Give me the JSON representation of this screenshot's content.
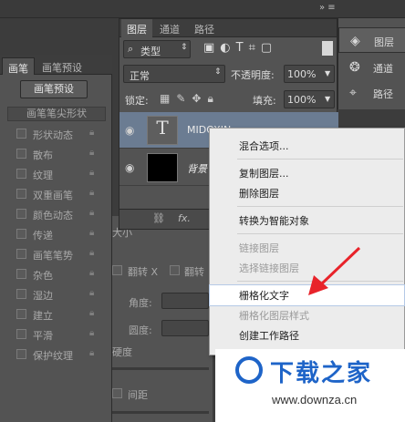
{
  "brush_panel": {
    "tabs": [
      "画笔",
      "画笔预设"
    ],
    "preset_button": "画笔预设",
    "section_title": "画笔笔尖形状",
    "options": [
      {
        "label": "形状动态",
        "locked": true
      },
      {
        "label": "散布",
        "locked": true
      },
      {
        "label": "纹理",
        "locked": true
      },
      {
        "label": "双重画笔",
        "locked": true
      },
      {
        "label": "颜色动态",
        "locked": true
      },
      {
        "label": "传递",
        "locked": true
      },
      {
        "label": "画笔笔势",
        "locked": true
      },
      {
        "label": "杂色",
        "locked": true
      },
      {
        "label": "湿边",
        "locked": true
      },
      {
        "label": "建立",
        "locked": true
      },
      {
        "label": "平滑",
        "locked": true
      },
      {
        "label": "保护纹理",
        "locked": true
      }
    ],
    "flip_x": "翻转 X",
    "flip_y": "翻转",
    "angle_label": "角度:",
    "roundness_label": "圆度:",
    "hardness_label": "硬度",
    "spacing_label": "间距",
    "size_label": "大小"
  },
  "layers_panel": {
    "tabs": [
      "图层",
      "通道",
      "路径"
    ],
    "filter_label": "类型",
    "blend_mode": "正常",
    "opacity_label": "不透明度:",
    "opacity_value": "100%",
    "lock_label": "锁定:",
    "fill_label": "填充:",
    "fill_value": "100%",
    "layers": [
      {
        "name": "MIDOXIN",
        "kind": "text"
      },
      {
        "name": "背景",
        "kind": "background"
      }
    ],
    "footer_fx": "fx."
  },
  "dock": {
    "items": [
      "图层",
      "通道",
      "路径"
    ]
  },
  "context_menu": {
    "items": [
      {
        "label": "混合选项...",
        "disabled": false,
        "highlight": false
      },
      {
        "label": "复制图层...",
        "disabled": false,
        "highlight": false
      },
      {
        "label": "删除图层",
        "disabled": false,
        "highlight": false
      },
      {
        "label": "转换为智能对象",
        "disabled": false,
        "highlight": false
      },
      {
        "label": "链接图层",
        "disabled": true,
        "highlight": false
      },
      {
        "label": "选择链接图层",
        "disabled": true,
        "highlight": false
      },
      {
        "label": "栅格化文字",
        "disabled": false,
        "highlight": true
      },
      {
        "label": "栅格化图层样式",
        "disabled": true,
        "highlight": false
      },
      {
        "label": "创建工作路径",
        "disabled": false,
        "highlight": false
      }
    ]
  },
  "watermark": {
    "title": "下载之家",
    "url": "www.downza.cn"
  },
  "colors": {
    "panel": "#535353",
    "arrow": "#e8232a",
    "watermark_blue": "#1e64c8"
  }
}
